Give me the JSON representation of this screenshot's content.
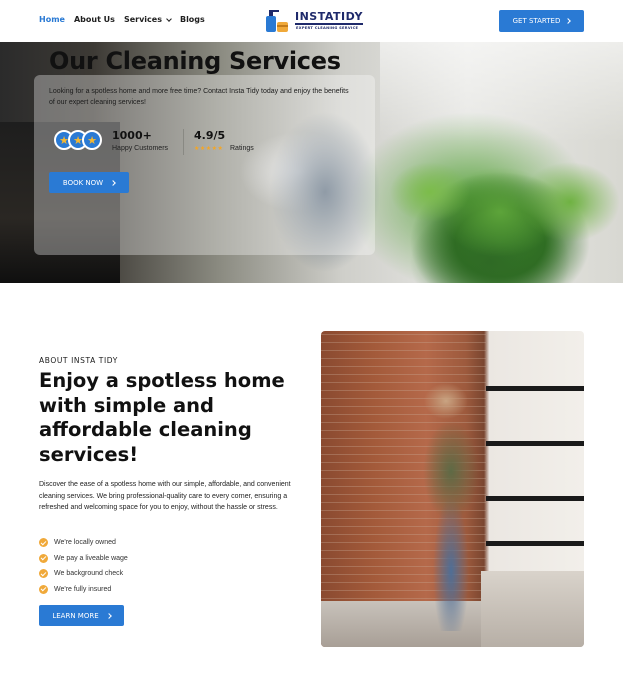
{
  "nav": {
    "links": [
      "Home",
      "About Us",
      "Services",
      "Blogs"
    ],
    "active": "Home",
    "logo_text": "INSTATIDY",
    "logo_tagline": "EXPERT CLEANING SERVICE",
    "cta": "GET STARTED"
  },
  "hero": {
    "title": "Our Cleaning Services",
    "description": "Looking for a spotless home and more free time? Contact Insta Tidy today and enjoy the benefits of our expert cleaning services!",
    "stat1_value": "1000+",
    "stat1_label": "Happy Customers",
    "stat2_value": "4.9/5",
    "stat2_stars": "★★★★★",
    "stat2_label": "Ratings",
    "button": "BOOK NOW"
  },
  "about": {
    "eyebrow": "ABOUT INSTA TIDY",
    "title": "Enjoy a spotless home with simple and affordable cleaning services!",
    "description": "Discover the ease of a spotless home with our simple, affordable, and convenient cleaning services. We bring professional-quality care to every corner, ensuring a refreshed and welcoming space for you to enjoy, without the hassle or stress.",
    "checklist": [
      "We're locally owned",
      "We pay a liveable wage",
      "We background check",
      "We're fully insured"
    ],
    "button": "LEARN MORE"
  },
  "colors": {
    "primary": "#2a7ad4",
    "accent": "#f0a93a",
    "star": "#f6a623"
  }
}
